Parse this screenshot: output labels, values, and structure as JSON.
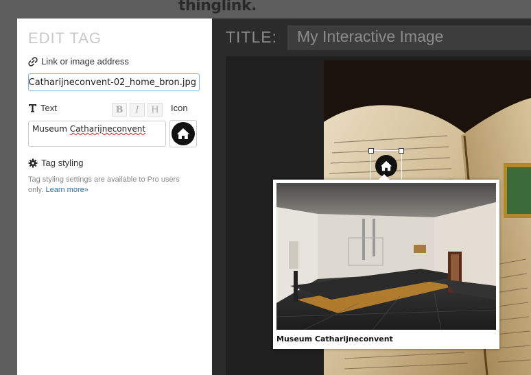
{
  "brand": {
    "logo_text": "thinglink."
  },
  "edit_panel": {
    "title": "EDIT TAG",
    "link_label": "Link or image address",
    "link_value": "Catharijneconvent-02_home_bron.jpg",
    "text_label": "Text",
    "format_buttons": [
      "B",
      "I",
      "H"
    ],
    "icon_label": "Icon",
    "text_value_prefix": "Museum ",
    "text_value_misspelled": "Catharijneconvent",
    "styling_label": "Tag styling",
    "styling_note": "Tag styling settings are available to Pro users only.",
    "learn_more": "Learn more»"
  },
  "editor": {
    "title_label": "TITLE:",
    "title_value": "My Interactive Image"
  },
  "popup": {
    "caption": "Museum Catharijneconvent"
  },
  "icons": {
    "link": "link-icon",
    "text": "text-icon",
    "gear": "gear-icon",
    "home": "home-icon"
  }
}
